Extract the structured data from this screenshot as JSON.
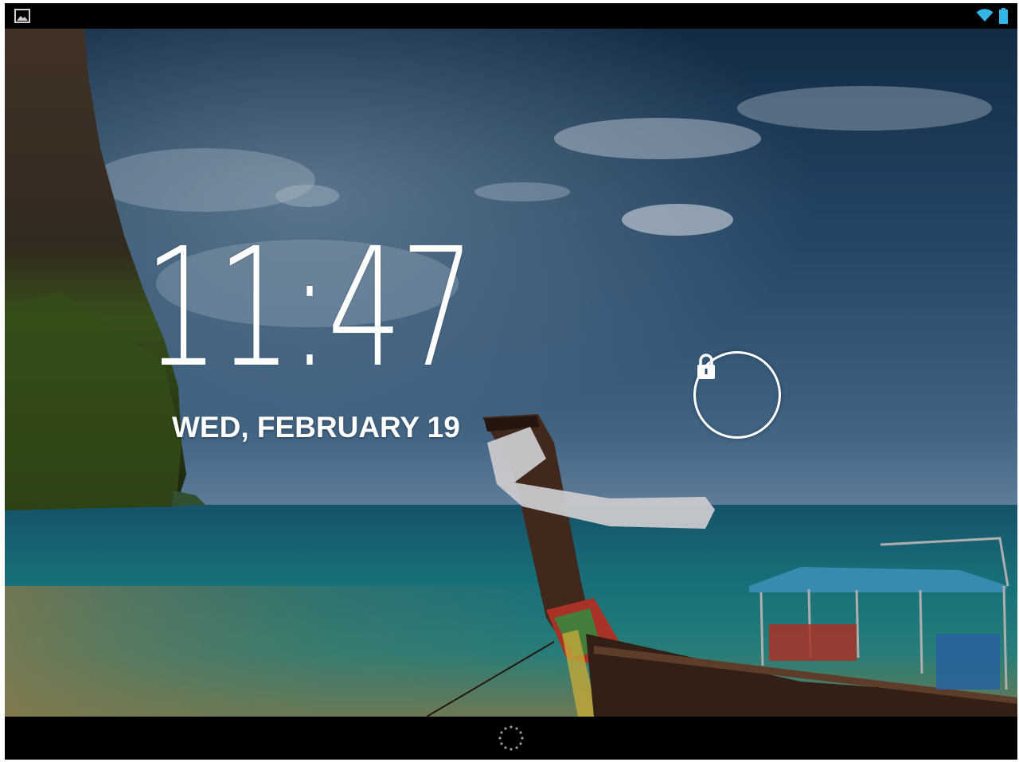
{
  "lockscreen": {
    "time": "11:47",
    "date": "WED, FEBRUARY 19"
  },
  "status_bar": {
    "left_icon": "gallery-icon",
    "right_icons": [
      "wifi-icon",
      "battery-icon"
    ]
  },
  "unlock": {
    "icon": "lock-icon"
  },
  "nav_bar": {
    "center_icon": "search-ring-icon"
  },
  "colors": {
    "sky": "#1c3a5e",
    "sea": "#1e8a94",
    "text": "#ffffff",
    "bars": "#000000"
  }
}
